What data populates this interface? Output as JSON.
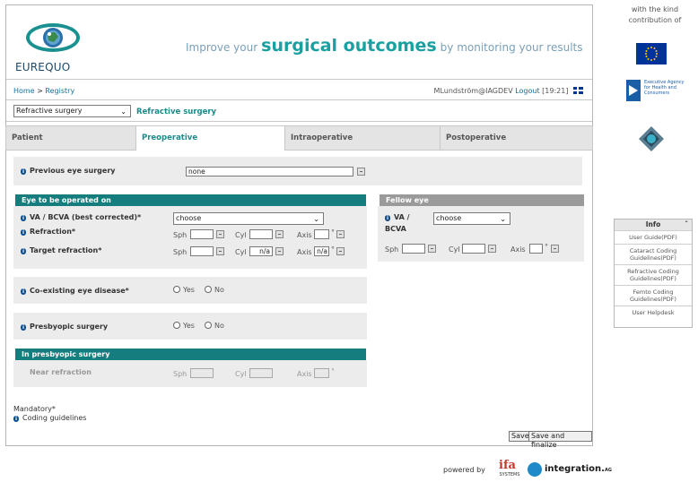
{
  "header": {
    "logo_text": "EUREQUO",
    "tagline_pre": "Improve your",
    "tagline_big": "surgical outcomes",
    "tagline_post": "by monitoring your results"
  },
  "nav": {
    "home": "Home",
    "sep": ">",
    "registry": "Registry",
    "user": "MLundström@IAGDEV",
    "logout": "Logout",
    "time": "[19:21]"
  },
  "procedure": {
    "selected": "Refractive surgery",
    "subtitle": "Refractive surgery"
  },
  "tabs": [
    "Patient",
    "Preoperative",
    "Intraoperative",
    "Postoperative"
  ],
  "previous": {
    "label": "Previous eye surgery",
    "value": "none"
  },
  "operated": {
    "heading": "Eye to be operated on",
    "va_label": "VA / BCVA (best corrected)*",
    "va_value": "choose",
    "refraction_label": "Refraction*",
    "target_label": "Target refraction*",
    "sph": "Sph",
    "cyl": "Cyl",
    "axis": "Axis",
    "deg": "°",
    "target_cyl_value": "n/a",
    "target_axis_value": "n/a"
  },
  "fellow": {
    "heading": "Fellow eye",
    "va_label": "VA /",
    "va_label2": "BCVA",
    "va_value": "choose",
    "sph": "Sph",
    "cyl": "Cyl",
    "axis": "Axis",
    "deg": "°"
  },
  "coexisting": {
    "label": "Co-existing eye disease*",
    "yes": "Yes",
    "no": "No"
  },
  "presbyopic": {
    "label": "Presbyopic surgery",
    "yes": "Yes",
    "no": "No"
  },
  "presby_section": {
    "heading": "In presbyopic surgery",
    "near_label": "Near refraction",
    "sph": "Sph",
    "cyl": "Cyl",
    "axis": "Axis",
    "deg": "°"
  },
  "footer": {
    "mandatory": "Mandatory*",
    "coding": "Coding guidelines",
    "save": "Save",
    "save_finalize": "Save and finalize"
  },
  "powered": {
    "text": "powered by",
    "ifa": "ifa",
    "ifa_sub": "SYSTEMS",
    "integration": "integration.",
    "integration_sub": "AG"
  },
  "sidebar": {
    "contribution": "with the kind contribution of",
    "eahc": "Executive Agency for Health and Consumers",
    "info_title": "Info",
    "items": [
      "User Guide(PDF)",
      "Cataract Coding Guidelines(PDF)",
      "Refractive Coding Guidelines(PDF)",
      "Femto Coding Guidelines(PDF)",
      "User Helpdesk"
    ]
  }
}
